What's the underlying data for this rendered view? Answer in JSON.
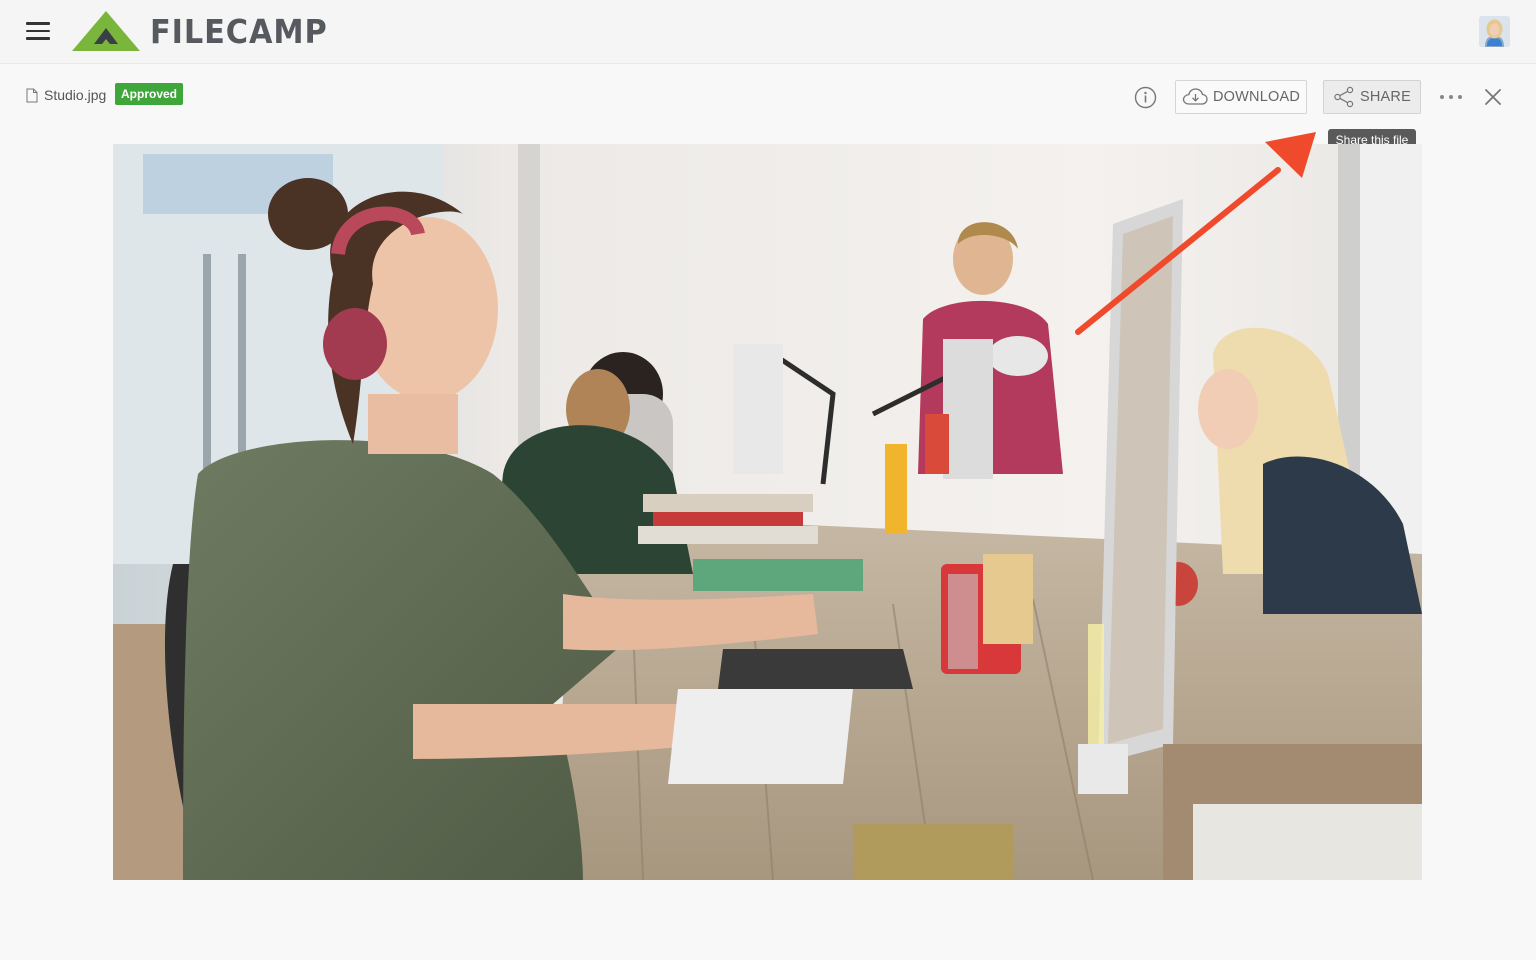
{
  "header": {
    "menu_icon": "hamburger-menu-icon",
    "brand": "FILECAMP",
    "brand_color": "#7ab63b",
    "avatar_icon": "user-avatar"
  },
  "file": {
    "name": "Studio.jpg",
    "status": "Approved",
    "status_color": "#3ea63a"
  },
  "toolbar": {
    "info_icon": "info-icon",
    "download_label": "DOWNLOAD",
    "share_label": "SHARE",
    "more_icon": "more-horizontal-icon",
    "close_icon": "close-icon"
  },
  "tooltip": {
    "text": "Share this file"
  },
  "annotation": {
    "arrow_color": "#f04a2c"
  },
  "preview": {
    "scene": "open office studio photo"
  }
}
